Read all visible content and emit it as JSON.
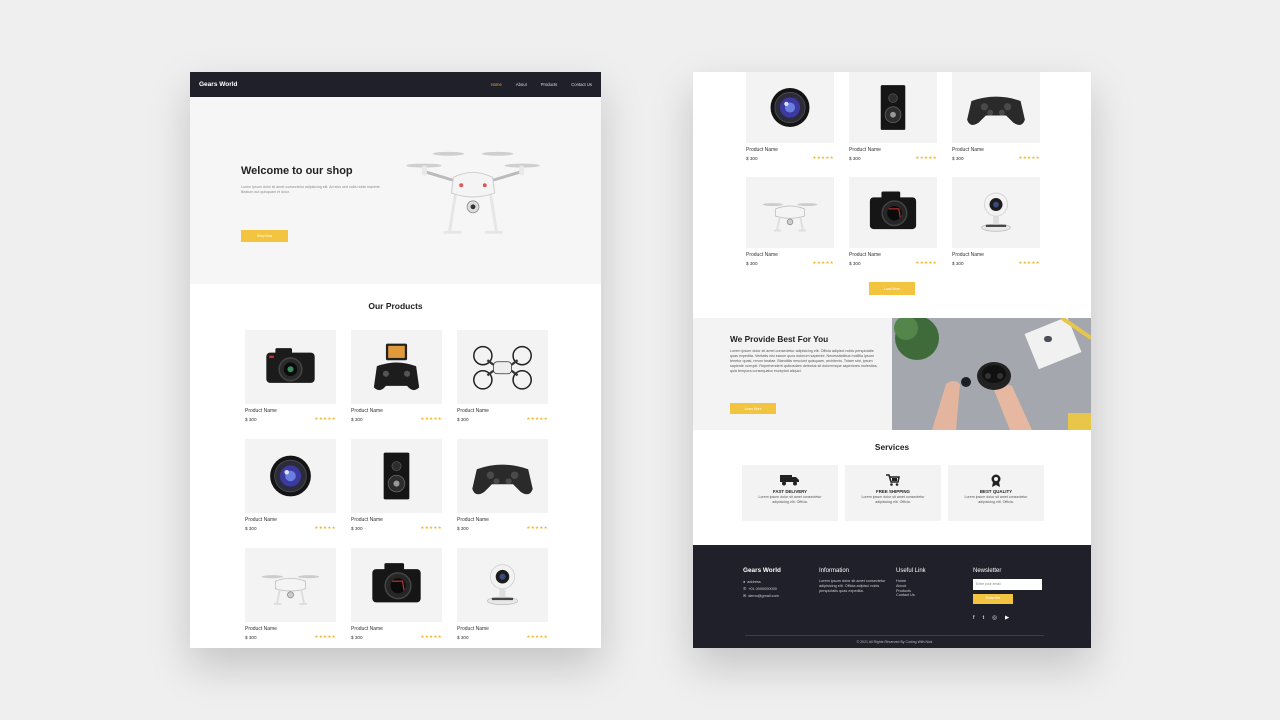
{
  "page1": {
    "nav": {
      "brand": "Gears World",
      "links": [
        "Home",
        "About",
        "Products",
        "Contact Us"
      ]
    },
    "hero": {
      "title": "Welcome to our shop",
      "text": "Lorem ipsum dolor sit amet consectetur adipisicing elit. Ad eius sed nulla nobis maxime. Beatum aut quisquam et dolor.",
      "button": "Shop Now"
    },
    "products_title": "Our Products",
    "products": [
      {
        "image": "dslr-camera",
        "name": "Product Name",
        "price": "$ 300",
        "stars": "★★★★★"
      },
      {
        "image": "phone-gamepad",
        "name": "Product Name",
        "price": "$ 300",
        "stars": "★★★★★"
      },
      {
        "image": "mini-drone",
        "name": "Product Name",
        "price": "$ 300",
        "stars": "★★★★★"
      },
      {
        "image": "camera-lens",
        "name": "Product Name",
        "price": "$ 300",
        "stars": "★★★★★"
      },
      {
        "image": "speaker",
        "name": "Product Name",
        "price": "$ 300",
        "stars": "★★★★★"
      },
      {
        "image": "gamepad",
        "name": "Product Name",
        "price": "$ 300",
        "stars": "★★★★★"
      },
      {
        "image": "white-drone",
        "name": "Product Name",
        "price": "$ 300",
        "stars": "★★★★★"
      },
      {
        "image": "camera-body",
        "name": "Product Name",
        "price": "$ 300",
        "stars": "★★★★★"
      },
      {
        "image": "webcam",
        "name": "Product Name",
        "price": "$ 300",
        "stars": "★★★★★"
      }
    ]
  },
  "page2": {
    "products": [
      {
        "image": "camera-lens",
        "name": "Product Name",
        "price": "$ 300",
        "stars": "★★★★★"
      },
      {
        "image": "speaker",
        "name": "Product Name",
        "price": "$ 300",
        "stars": "★★★★★"
      },
      {
        "image": "gamepad",
        "name": "Product Name",
        "price": "$ 300",
        "stars": "★★★★★"
      },
      {
        "image": "white-drone",
        "name": "Product Name",
        "price": "$ 300",
        "stars": "★★★★★"
      },
      {
        "image": "camera-body",
        "name": "Product Name",
        "price": "$ 300",
        "stars": "★★★★★"
      },
      {
        "image": "webcam",
        "name": "Product Name",
        "price": "$ 300",
        "stars": "★★★★★"
      }
    ],
    "more_button": "Load More",
    "about": {
      "title": "We Provide Best For You",
      "text": "Lorem ipsum dolor sit amet consectetur adipisicing elit. Officia adipisci nobis perspiciatis quas expedita. Veritatis nisi earum quos dolorum sapiente. Necessitatibus mollitia ipsum tenetur quasi, rerum beatae. Blanditiis nesciunt quisquam, architecto. Totam sint, ipsum sapiente corrupti. Reprehenderit quibusdam delectus sit doloremque asperiores molestias, quia tempora consequatur excepturi aliquid.",
      "button": "Learn More"
    },
    "services_title": "Services",
    "services": [
      {
        "icon": "truck-icon",
        "title": "FAST DELIVERY",
        "text": "Lorem ipsum dolor sit amet consectetur adipisicing elit. Officia."
      },
      {
        "icon": "cart-icon",
        "title": "FREE SHIPPING",
        "text": "Lorem ipsum dolor sit amet consectetur adipisicing elit. Officia."
      },
      {
        "icon": "award-icon",
        "title": "BEST QUALITY",
        "text": "Lorem ipsum dolor sit amet consectetur adipisicing elit. Officia."
      }
    ],
    "footer": {
      "brand": "Gears World",
      "contact": [
        "address",
        "+01 0000000000",
        "demo@gmail.com"
      ],
      "info_title": "Information",
      "info_text": "Lorem ipsum dolor sit amet consectetur adipisicing elit. Officia adipisci nobis perspiciatis quas expedita.",
      "links_title": "Useful Link",
      "links": [
        "Home",
        "About",
        "Products",
        "Contact Us"
      ],
      "newsletter_title": "Newsletter",
      "newsletter_placeholder": "Enter your email",
      "subscribe": "Subscribe",
      "copyright": "© 2021 All Rights Reserved By Coding With Nick"
    }
  },
  "colors": {
    "accent": "#f3c43f",
    "dark": "#1f2029",
    "nav_active": "#e8a33b",
    "star": "#f3b82f"
  }
}
